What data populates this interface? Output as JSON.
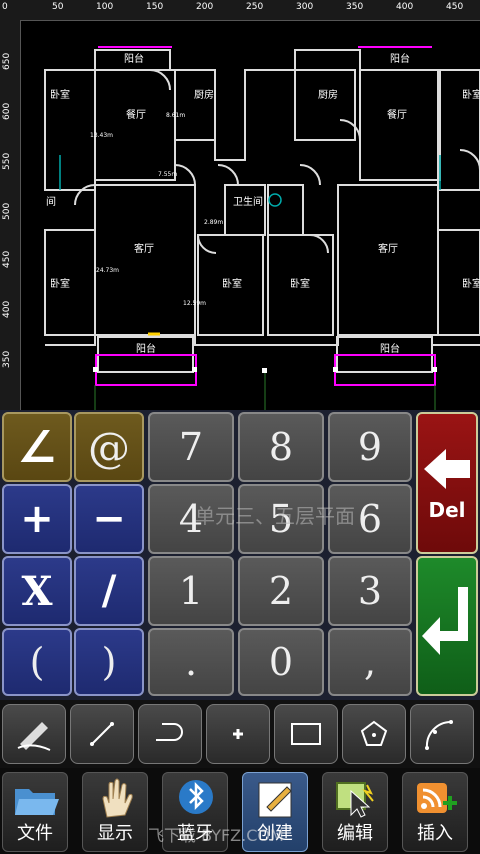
{
  "ruler": {
    "top_labels": [
      "0",
      "50",
      "100",
      "150",
      "200",
      "250",
      "300",
      "350",
      "400",
      "450"
    ],
    "left_labels": [
      "650",
      "600",
      "550",
      "500",
      "450",
      "400",
      "350"
    ]
  },
  "drawing": {
    "rooms": [
      "阳台",
      "阳台",
      "卧室",
      "卧室",
      "餐厅",
      "餐厅",
      "厨房",
      "厨房",
      "卫生间",
      "客厅",
      "客厅",
      "卧室",
      "卧室",
      "卧室",
      "卧室",
      "卧室",
      "卧室",
      "阳台",
      "阳台",
      "间"
    ],
    "dims": [
      "13.43m",
      "8.61m",
      "7.55m",
      "2.89m",
      "24.73m",
      "12.59m"
    ]
  },
  "keypad": {
    "angle": "∠",
    "at": "@",
    "plus": "+",
    "minus": "−",
    "times": "X",
    "divide": "/",
    "lparen": "(",
    "rparen": ")",
    "n7": "7",
    "n8": "8",
    "n9": "9",
    "n4": "4",
    "n5": "5",
    "n6": "6",
    "n1": "1",
    "n2": "2",
    "n3": "3",
    "n0": "0",
    "dot": ".",
    "comma": ",",
    "del": "Del",
    "overlay": "单元三、五层平面"
  },
  "tabs": [
    "文件",
    "显示",
    "蓝牙",
    "创建",
    "编辑",
    "插入"
  ],
  "watermark": "飞下载 BYFZ.COM",
  "colors": {
    "gold": "#6e5a1e",
    "blue": "#1e2a70",
    "red": "#9a1414",
    "green": "#1e8a2a",
    "magenta": "#ff00ff"
  }
}
